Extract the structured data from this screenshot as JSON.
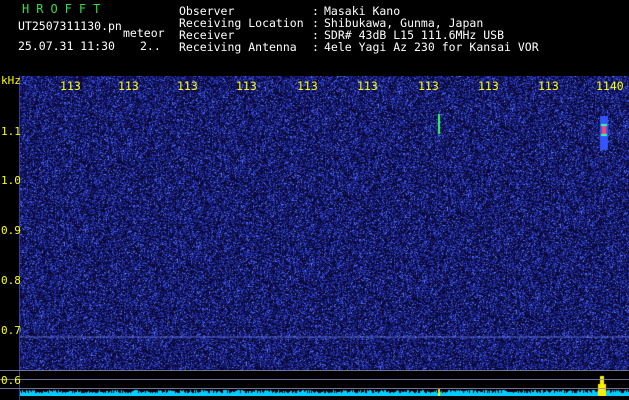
{
  "header": {
    "app_title": "HROFFT",
    "file_name": "UT2507311130.pn",
    "meteor_tag": "meteor",
    "timestamp": "25.07.31 11:30",
    "timestamp_extra": "2..",
    "info": [
      {
        "label": "Observer",
        "value": "Masaki Kano"
      },
      {
        "label": "Receiving Location",
        "value": "Shibukawa, Gunma, Japan"
      },
      {
        "label": "Receiver",
        "value": "SDR# 43dB L15 111.6MHz USB"
      },
      {
        "label": "Receiving Antenna",
        "value": "4ele Yagi Az 230 for Kansai VOR"
      }
    ],
    "separator": ":"
  },
  "axes": {
    "unit_label": "kHz",
    "x_ticks": [
      "113",
      "113",
      "113",
      "113",
      "113",
      "113",
      "113",
      "113",
      "113",
      "1140"
    ],
    "y_ticks": [
      "1.1",
      "1.0",
      "0.9",
      "0.8",
      "0.7",
      "0.6"
    ]
  },
  "colors": {
    "title_green": "#33dd44",
    "tick_yellow": "#ffff00",
    "plot_bg": "#0a0a38",
    "noise_blue": "#2f3fe0",
    "signal_green": "#33ff66",
    "spectrum_cyan": "#00ccff"
  }
}
